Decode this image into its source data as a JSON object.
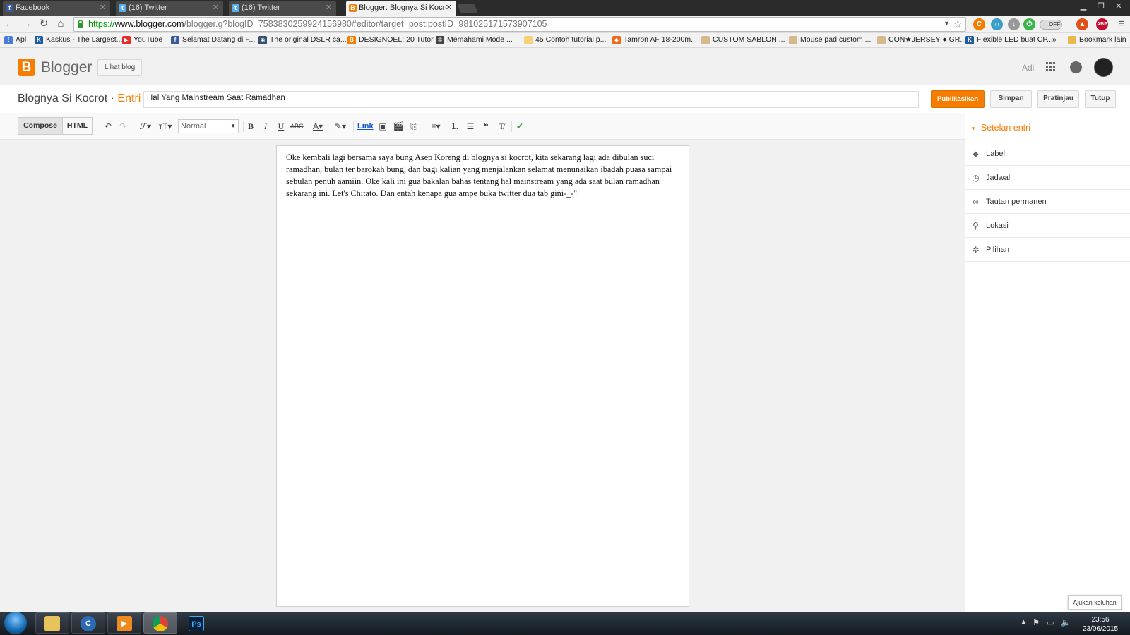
{
  "browser": {
    "tabs": [
      {
        "label": "Facebook",
        "icon": "facebook-icon",
        "color": "#3b5998"
      },
      {
        "label": "(16) Twitter",
        "icon": "twitter-icon",
        "color": "#55acee"
      },
      {
        "label": "(16) Twitter",
        "icon": "twitter-icon",
        "color": "#55acee"
      },
      {
        "label": "Blogger: Blognya Si Kocrot",
        "icon": "blogger-icon",
        "color": "#f57d00"
      }
    ],
    "active_tab": 3,
    "url_scheme": "https://",
    "url_host": "www.blogger.com",
    "url_path": "/blogger.g?blogID=7583830259924156980#editor/target=post;postID=981025171573907105",
    "toggle_label": "OFF",
    "bookmarks": [
      {
        "label": "Apl",
        "icon": "apps-icon"
      },
      {
        "label": "Kaskus - The Largest...",
        "icon": "kaskus-icon"
      },
      {
        "label": "YouTube",
        "icon": "youtube-icon"
      },
      {
        "label": "Selamat Datang di F...",
        "icon": "facebook-icon"
      },
      {
        "label": "The original DSLR ca...",
        "icon": "camera-icon"
      },
      {
        "label": "DESIGNOEL: 20 Tutor...",
        "icon": "blogger-icon"
      },
      {
        "label": "Memahami Mode ...",
        "icon": "gear-icon"
      },
      {
        "label": "45 Contoh tutorial p...",
        "icon": "folder-icon"
      },
      {
        "label": "Tamron AF 18-200m...",
        "icon": "shop-icon"
      },
      {
        "label": "CUSTOM SABLON ...",
        "icon": "page-icon"
      },
      {
        "label": "Mouse pad custom ...",
        "icon": "page-icon"
      },
      {
        "label": "CON★JERSEY ● GR...",
        "icon": "page-icon"
      },
      {
        "label": "Flexible LED buat CP...",
        "icon": "kaskus-icon"
      }
    ],
    "more_bookmarks": "»",
    "other_bookmarks": "Bookmark lain"
  },
  "blogger": {
    "logo_text": "Blogger",
    "view_blog_label": "Lihat blog",
    "username": "Adi",
    "blog_name": "Blognya Si Kocrot",
    "separator": "·",
    "section": "Entri",
    "post_title": "Hal Yang Mainstream Saat Ramadhan",
    "actions": {
      "publish": "Publikasikan",
      "save": "Simpan",
      "preview": "Pratinjau",
      "close": "Tutup"
    },
    "toolbar": {
      "compose": "Compose",
      "html": "HTML",
      "format_value": "Normal",
      "link": "Link"
    },
    "body_text": "Oke kembali lagi bersama saya bung Asep Koreng di blognya si kocrot, kita sekarang lagi ada dibulan suci ramadhan, bulan ter barokah bung, dan bagi kalian yang menjalankan selamat menunaikan ibadah puasa sampai sebulan penuh aamiin. Oke kali ini gua bakalan bahas tentang hal mainstream yang ada saat bulan ramadhan sekarang ini. Let's Chitato. Dan entah kenapa gua ampe buka twitter dua tab gini-_-\"",
    "sidebar": {
      "heading": "Setelan entri",
      "items": [
        {
          "label": "Label",
          "icon": "tag-icon"
        },
        {
          "label": "Jadwal",
          "icon": "clock-icon"
        },
        {
          "label": "Tautan permanen",
          "icon": "link-icon"
        },
        {
          "label": "Lokasi",
          "icon": "location-pin-icon"
        },
        {
          "label": "Pilihan",
          "icon": "gear-icon"
        }
      ]
    },
    "feedback_label": "Ajukan keluhan"
  },
  "taskbar": {
    "apps": [
      {
        "name": "explorer",
        "icon": "folder-icon"
      },
      {
        "name": "ccleaner",
        "icon": "ccleaner-icon"
      },
      {
        "name": "media-player",
        "icon": "media-player-icon"
      },
      {
        "name": "chrome",
        "icon": "chrome-icon"
      },
      {
        "name": "photoshop",
        "icon": "photoshop-icon",
        "label": "Ps"
      }
    ],
    "time": "23:56",
    "date": "23/06/2015"
  }
}
